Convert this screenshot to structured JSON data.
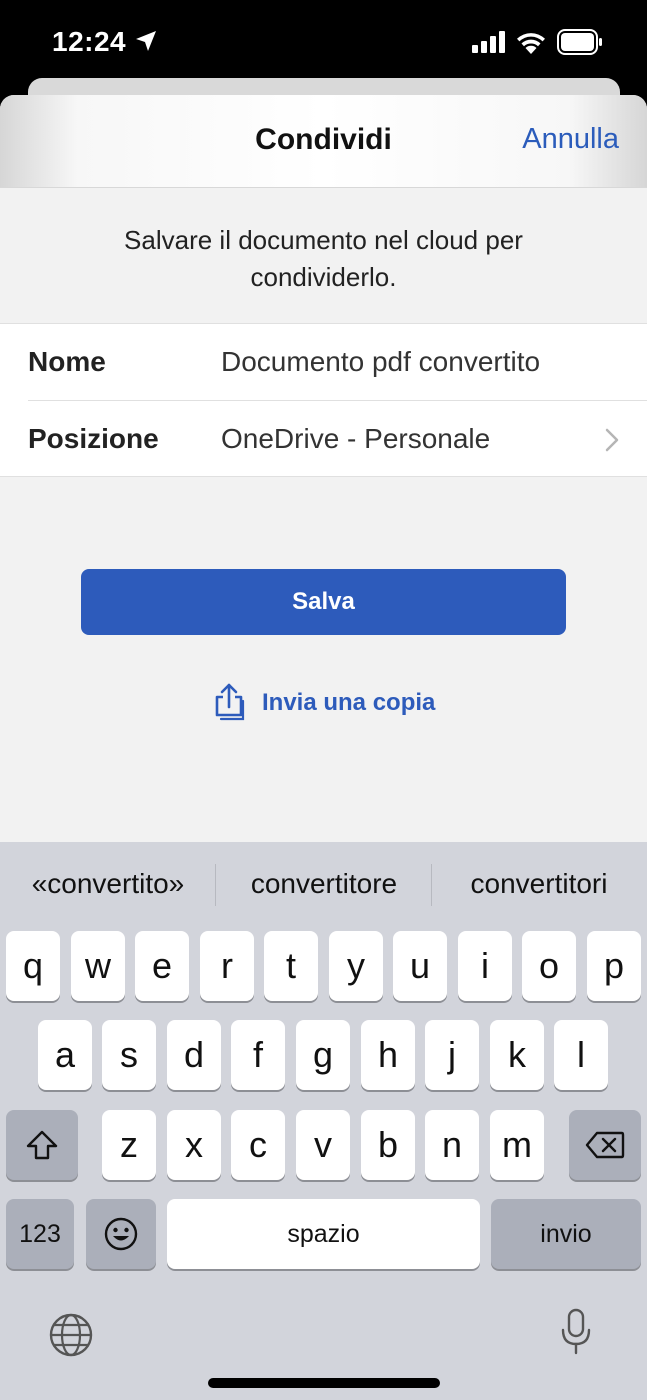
{
  "status_bar": {
    "time": "12:24"
  },
  "sheet": {
    "title": "Condividi",
    "cancel_label": "Annulla",
    "info_text": "Salvare il documento nel cloud per condividerlo.",
    "fields": [
      {
        "label": "Nome",
        "value": "Documento pdf convertito"
      },
      {
        "label": "Posizione",
        "value": "OneDrive - Personale"
      }
    ],
    "save_label": "Salva",
    "send_copy_label": "Invia una copia"
  },
  "keyboard": {
    "suggestions": [
      "«convertito»",
      "convertitore",
      "convertitori"
    ],
    "row1": [
      "q",
      "w",
      "e",
      "r",
      "t",
      "y",
      "u",
      "i",
      "o",
      "p"
    ],
    "row2": [
      "a",
      "s",
      "d",
      "f",
      "g",
      "h",
      "j",
      "k",
      "l"
    ],
    "row3": [
      "z",
      "x",
      "c",
      "v",
      "b",
      "n",
      "m"
    ],
    "numbers_label": "123",
    "space_label": "spazio",
    "return_label": "invio"
  },
  "colors": {
    "accent": "#2d5bbb",
    "keyboard_bg": "#d2d4db"
  }
}
